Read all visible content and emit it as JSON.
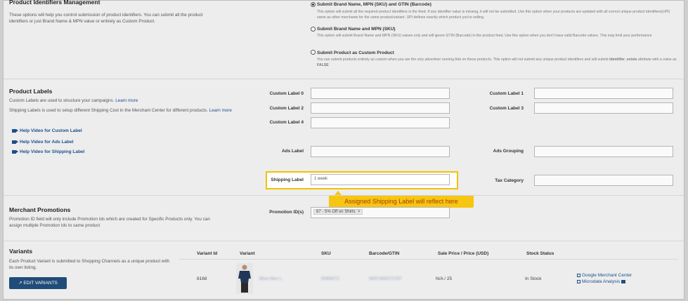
{
  "identifiers": {
    "title": "Product Identifiers Management",
    "description": "These options will help you control submission of product identifiers. You can submit all the product identifiers or just Brand Name & MPN value or entirely as Custom Product.",
    "options": [
      {
        "title": "Submit Brand Name, MPN (SKU) and GTIN (Barcode)",
        "desc": "This option will submit all the required product identifiers in the feed. If any identifier value is missing, it will not be submitted. Use this option when your products are updated with all correct unique product identifiers(UPI) same as other merchants for the same product/variant. UPI defines exactly which product you're selling.",
        "selected": true
      },
      {
        "title": "Submit Brand Name and MPN (SKU)",
        "desc": "This option will submit Brand Name and MPN (SKU) values only and will ignore GTIN (Barcode) in the product feed. Use this option when you don't have valid Barcode values. This may limit your performance",
        "selected": false
      },
      {
        "title": "Submit Product as Custom Product",
        "desc_a": "You can submit products entirely as custom when you are the only advertiser running Ads on these products. This option will not submit any unique product identifiers and will submit",
        "desc_b": "identifier_exists",
        "desc_c": "attribute with a value as",
        "desc_d": "FALSE",
        "selected": false
      }
    ]
  },
  "labels": {
    "title": "Product Labels",
    "desc1": "Custom Labels are used to structure your campaigns.",
    "desc1_link": "Learn more",
    "desc2": "Shipping Labels is used to setup different Shipping Cost in the Merchant Center for different products.",
    "desc2_link_a": "Learn",
    "desc2_link_b": "more",
    "help_custom": "Help Video for Custom Label",
    "help_ads": "Help Video for Ads Label",
    "help_shipping": "Help Video for Shipping Label",
    "custom_label_0": "Custom Label 0",
    "custom_label_1": "Custom Label 1",
    "custom_label_2": "Custom Label 2",
    "custom_label_3": "Custom Label 3",
    "custom_label_4": "Custom Label 4",
    "ads_label": "Ads Label",
    "ads_grouping": "Ads Grouping",
    "shipping_label": "Shipping Label",
    "shipping_value": "1 week",
    "tax_category": "Tax Category",
    "callout": "Assigned Shipping Label will reflect here"
  },
  "promotions": {
    "title": "Merchant Promotions",
    "desc": "Promotion ID field will only include Promotion Ids which are created for Specific Products only. You can assign multiple Promotion Ids to same product",
    "field_label": "Promotion ID(s)",
    "chip": "87 - 5% Off on Shirts",
    "chip_remove": "×"
  },
  "variants": {
    "title": "Variants",
    "desc": "Each Product Variant is submitted to Shopping Channels as a unique product with its own listing.",
    "edit_button": "EDIT VARIANTS",
    "columns": [
      "Variant Id",
      "Variant",
      "SKU",
      "Barcode/GTIN",
      "Sale Price / Price (USD)",
      "Stock Status"
    ],
    "row": {
      "id": "8168",
      "variant": "Blue Men L",
      "sku": "9068673",
      "barcode": "9897486373787",
      "price": "N/A / 25",
      "stock": "In Stock"
    },
    "links": {
      "gmc": "Google Merchant Center",
      "microdata": "Microdata Analysis"
    }
  },
  "colors": {
    "accent": "#1f4c78",
    "highlight": "#f6c613",
    "callout_text": "#b03a00"
  }
}
